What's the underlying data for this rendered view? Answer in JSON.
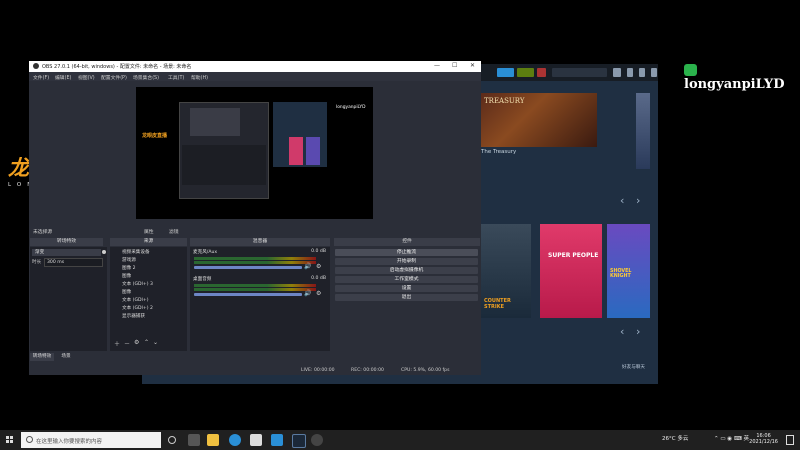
{
  "watermark": {
    "text": "longyanpiLYD"
  },
  "logo": {
    "title": "龙眼皮直播",
    "subtitle": "LONGYANPI"
  },
  "obs": {
    "title": "OBS 27.0.1 (64-bit, windows) - 配置文件: 未命名 - 场景: 未命名",
    "menu": [
      "文件(F)",
      "编辑(E)",
      "视图(V)",
      "配置文件(P)",
      "场景集合(S)",
      "工具(T)",
      "帮助(H)"
    ],
    "preview": {
      "overlay_text": "龙眼皮直播",
      "watermark": "longyanpiLYD"
    },
    "source_bar": {
      "selected": "未选择源",
      "properties": "属性",
      "filters": "滤镜"
    },
    "panels": {
      "transitions": "转场特效",
      "sources": "来源",
      "mixer": "混音器",
      "controls": "控件"
    },
    "transitions": {
      "type": "渐变",
      "duration_label": "时长",
      "duration": "300 ms"
    },
    "sources": [
      "视频采集设备",
      "游戏源",
      "图像 2",
      "图像",
      "文本 (GDI+) 3",
      "图像",
      "文本 (GDI+)",
      "文本 (GDI+) 2",
      "显示器捕获"
    ],
    "mixer": [
      {
        "label": "麦克风/Aux",
        "db": "0.0 dB"
      },
      {
        "label": "桌面音频",
        "db": "0.0 dB"
      }
    ],
    "controls": [
      "停止推流",
      "开始录制",
      "启动虚拟摄像机",
      "工作室模式",
      "设置",
      "退出"
    ],
    "bottom_tabs": [
      "转场特效",
      "场景"
    ],
    "status": {
      "live": "LIVE: 00:00:00",
      "rec": "REC: 00:00:00",
      "cpu": "CPU: 5.9%, 60.00 fps"
    }
  },
  "steam": {
    "featured_title": "The Treasury",
    "featured_sub": "TREASURY",
    "tiles": [
      "COUNTER STRIKE",
      "SUPER PEOPLE",
      "SHOVEL KNIGHT"
    ],
    "friends_label": "好友与聊天"
  },
  "taskbar": {
    "search_placeholder": "在这里输入你要搜索的内容",
    "weather": "26°C 多云",
    "time": "16:06",
    "date": "2021/12/16"
  },
  "colors": {
    "obs_bg": "#2b2e38",
    "steam_bg": "#1b2838",
    "accent_orange": "#f0a020",
    "wechat_green": "#2bb24c"
  }
}
